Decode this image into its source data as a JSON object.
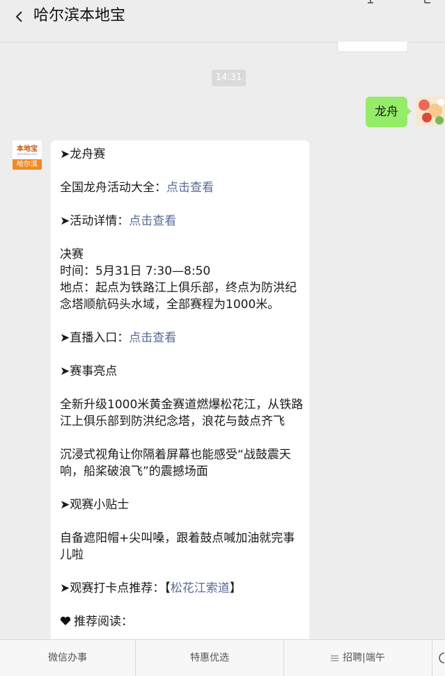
{
  "header": {
    "title": "哈尔滨本地宝"
  },
  "timestamp": "14:31",
  "my_message": {
    "text": "龙舟"
  },
  "sender": {
    "logo": "本地宝",
    "logo_sub": "bendibao.com",
    "city": "哈尔滨"
  },
  "message": {
    "section1": "➤龙舟赛",
    "all_label": "全国龙舟活动大全：",
    "all_link": "点击查看",
    "detail_label": "➤活动详情：",
    "detail_link": "点击查看",
    "final_title": "决赛",
    "final_time": "时间：5月31日 7:30—8:50",
    "final_place": "地点：起点为铁路江上俱乐部，终点为防洪纪念塔顺航码头水域，全部赛程为1000米。",
    "live_label": "➤直播入口：",
    "live_link": "点击查看",
    "highlights_title": "➤赛事亮点",
    "highlight1": "全新升级1000米黄金赛道燃爆松花江，从铁路江上俱乐部到防洪纪念塔，浪花与鼓点齐飞",
    "highlight2": "沉浸式视角让你隔着屏幕也能感受“战鼓震天响，船桨破浪飞”的震撼场面",
    "tips_title": "➤观赛小贴士",
    "tips_text": "自备遮阳帽+尖叫嗓，跟着鼓点喊加油就完事儿啦",
    "spot_label": "➤观赛打卡点推荐：【",
    "spot_link": "松花江索道",
    "spot_end": "】",
    "recommend": "推荐阅读："
  },
  "bottom_tabs": [
    "微信办事",
    "特惠优选",
    "招聘|端午"
  ],
  "colors": {
    "link": "#576b95",
    "bubble_green": "#95ec69",
    "background": "#ededed"
  }
}
